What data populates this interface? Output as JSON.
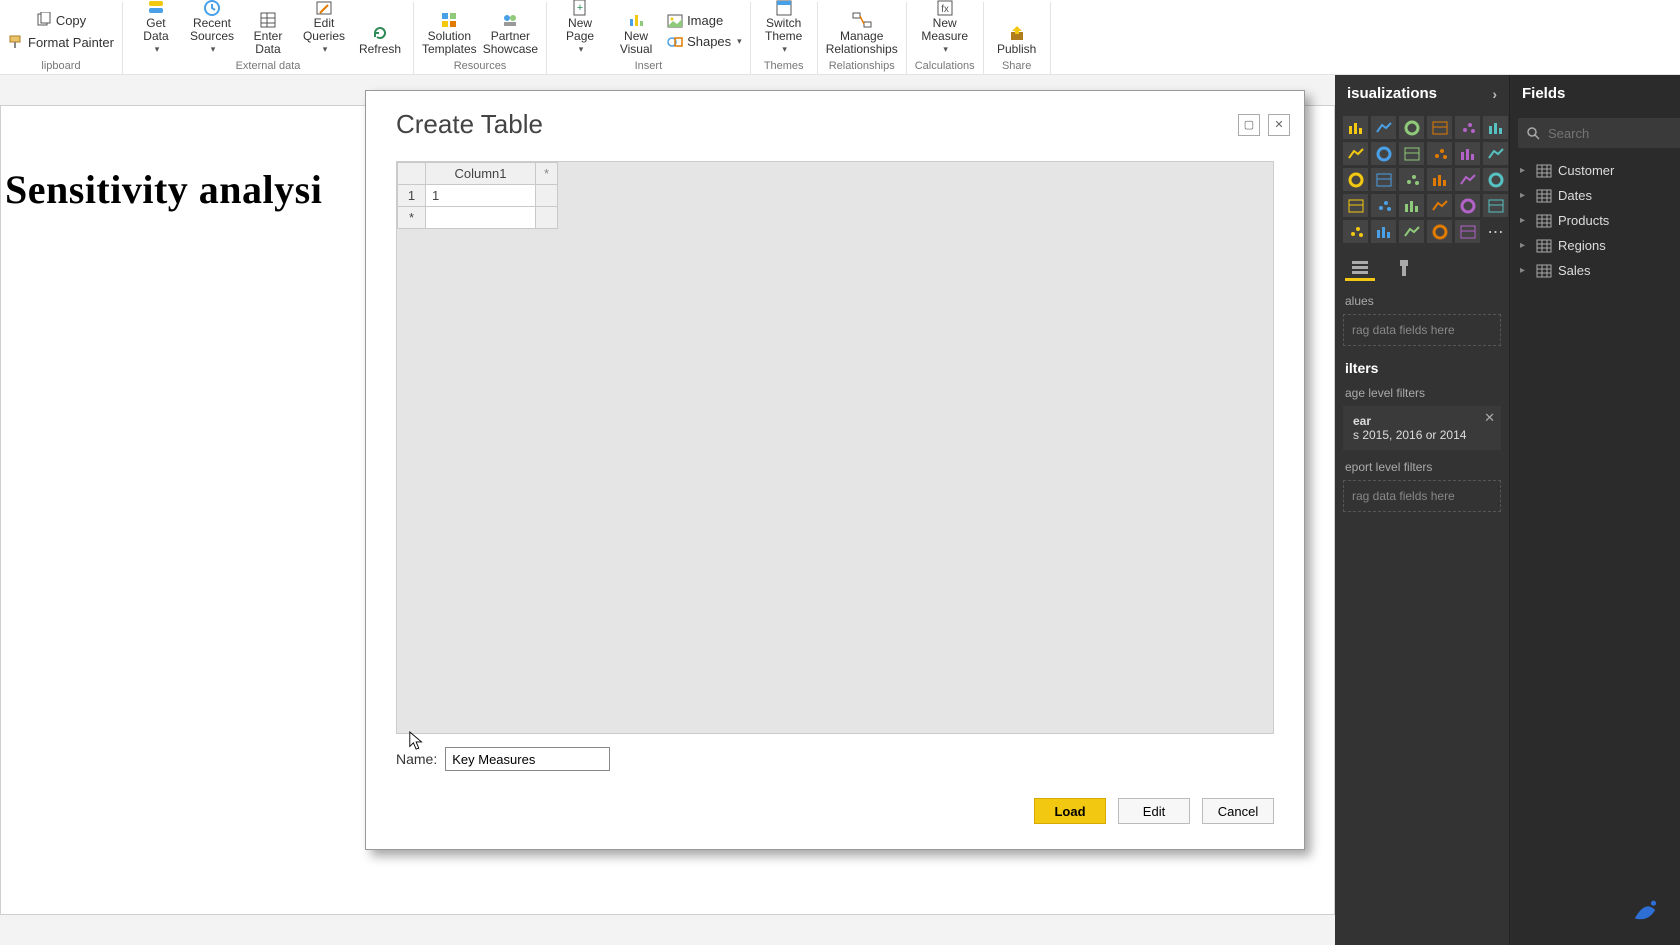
{
  "ribbon": {
    "clipboard": {
      "copy": "Copy",
      "format_painter": "Format Painter",
      "group": "lipboard"
    },
    "external": {
      "get_data": "Get\nData",
      "recent_sources": "Recent\nSources",
      "enter_data": "Enter\nData",
      "edit_queries": "Edit\nQueries",
      "refresh": "Refresh",
      "group": "External data"
    },
    "resources": {
      "solution": "Solution\nTemplates",
      "partner": "Partner\nShowcase",
      "group": "Resources"
    },
    "insert": {
      "new_page": "New\nPage",
      "new_visual": "New\nVisual",
      "image": "Image",
      "shapes": "Shapes",
      "group": "Insert"
    },
    "themes": {
      "switch_theme": "Switch\nTheme",
      "group": "Themes"
    },
    "relationships": {
      "manage": "Manage\nRelationships",
      "group": "Relationships"
    },
    "calculations": {
      "new_measure": "New\nMeasure",
      "group": "Calculations"
    },
    "share": {
      "publish": "Publish",
      "group": "Share"
    }
  },
  "canvas": {
    "page_title": "Sensitivity analysi"
  },
  "dialog": {
    "title": "Create Table",
    "column_header": "Column1",
    "add_col_marker": "*",
    "row1_num": "1",
    "row1_val": "1",
    "row2_num": "*",
    "name_label": "Name:",
    "name_value": "Key Measures",
    "load": "Load",
    "edit": "Edit",
    "cancel": "Cancel"
  },
  "viz_panel": {
    "title": "isualizations",
    "values_label": "alues",
    "values_drop": "rag data fields here",
    "filters_title": "ilters",
    "page_filters_label": "age level filters",
    "filter_card_title": "ear",
    "filter_card_sub": "s 2015, 2016 or 2014",
    "report_filters_label": "eport level filters",
    "report_drop": "rag data fields here"
  },
  "fields_panel": {
    "title": "Fields",
    "search_placeholder": "Search",
    "tables": [
      "Customer",
      "Dates",
      "Products",
      "Regions",
      "Sales"
    ]
  }
}
